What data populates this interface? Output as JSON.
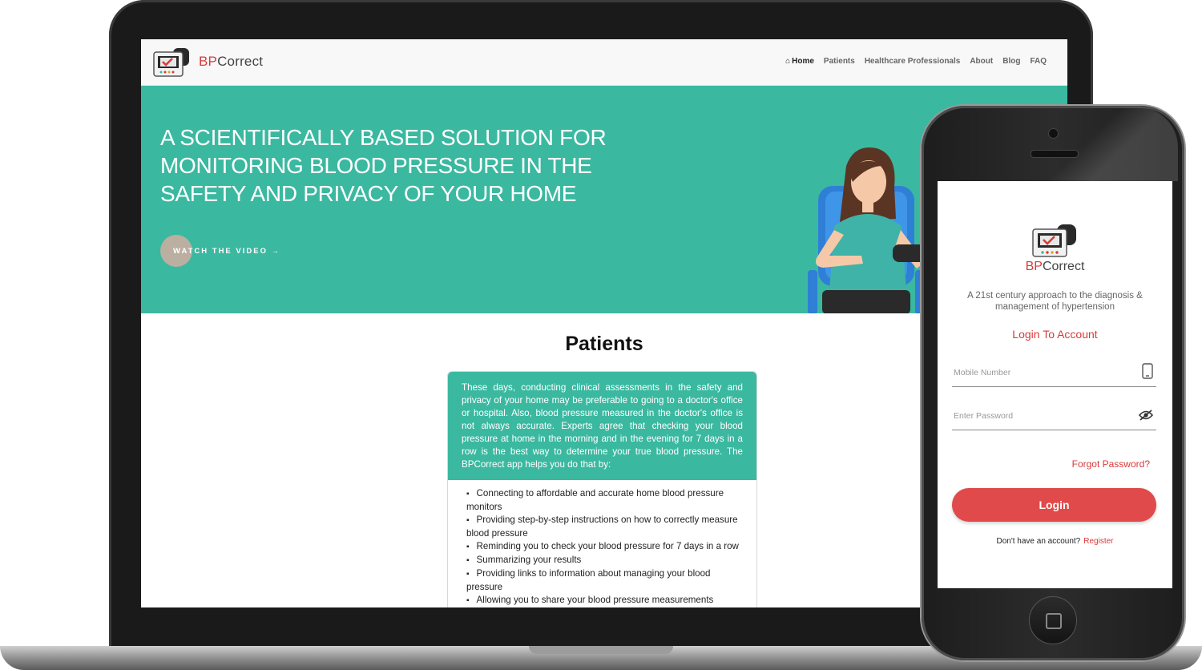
{
  "website": {
    "brand_prefix": "BP",
    "brand_suffix": "Correct",
    "nav": {
      "home": "Home",
      "items": [
        "Patients",
        "Healthcare Professionals",
        "About",
        "Blog",
        "FAQ"
      ]
    },
    "hero": {
      "title": "A SCIENTIFICALLY BASED SOLUTION FOR MONITORING BLOOD PRESSURE IN THE SAFETY AND PRIVACY OF YOUR HOME",
      "watch_button": "WATCH THE VIDEO"
    },
    "section_title": "Patients",
    "card": {
      "intro": "These days, conducting clinical assessments in the safety and privacy of your home may be preferable to going to a doctor's office or hospital. Also, blood pressure measured in the doctor's office is not always accurate. Experts agree that checking your blood pressure at home in the morning and in the evening for 7 days in a row is the best way to determine your true blood pressure. The BPCorrect app helps you do that by:",
      "bullets": [
        "Connecting to affordable and accurate home blood pressure monitors",
        "Providing step-by-step instructions on how to correctly measure blood pressure",
        "Reminding you to check your blood pressure for 7 days in a row",
        "Summarizing your results",
        "Providing links to information about managing your blood pressure",
        "Allowing you to share your blood pressure measurements"
      ]
    }
  },
  "app": {
    "brand_prefix": "BP",
    "brand_suffix": "Correct",
    "tagline": "A 21st century approach to the diagnosis & management of hypertension",
    "login_title": "Login To Account",
    "mobile_placeholder": "Mobile Number",
    "password_placeholder": "Enter Password",
    "forgot_password": "Forgot Password?",
    "login_button": "Login",
    "no_account": "Don't have an account?",
    "register": "Register"
  },
  "colors": {
    "accent_teal": "#3bb8a0",
    "brand_red": "#d93a3a",
    "button_red": "#e04a4a"
  },
  "icons": [
    "home-icon",
    "arrow-right-icon",
    "bp-monitor-logo-icon",
    "mobile-phone-icon",
    "eye-slash-icon"
  ]
}
